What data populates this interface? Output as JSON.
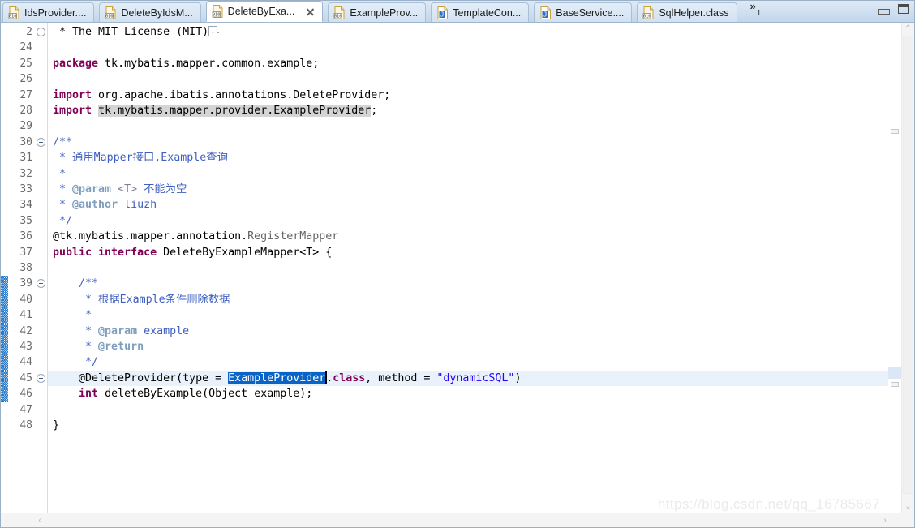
{
  "window": {
    "minimize_label": "Minimize",
    "maximize_label": "Maximize"
  },
  "tabs": {
    "overflow_chevron": "»",
    "overflow_count": "1",
    "items": [
      {
        "label": "IdsProvider....",
        "icon": "class-file-icon",
        "active": false,
        "closable": false
      },
      {
        "label": "DeleteByIdsM...",
        "icon": "class-file-icon",
        "active": false,
        "closable": false
      },
      {
        "label": "DeleteByExa...",
        "icon": "class-file-icon",
        "active": true,
        "closable": true
      },
      {
        "label": "ExampleProv...",
        "icon": "class-file-icon",
        "active": false,
        "closable": false
      },
      {
        "label": "TemplateCon...",
        "icon": "java-file-icon",
        "active": false,
        "closable": false
      },
      {
        "label": "BaseService....",
        "icon": "java-file-icon",
        "active": false,
        "closable": false
      },
      {
        "label": "SqlHelper.class",
        "icon": "class-file-icon",
        "active": false,
        "closable": false
      }
    ]
  },
  "editor": {
    "first_visible_line": 2,
    "current_line": 45,
    "selection_text": "ExampleProvider",
    "colors": {
      "keyword": "#7f0055",
      "javadoc": "#3f5fbf",
      "javadoc_tag": "#7f9fbf",
      "comment": "#3f7f5f",
      "string": "#2a00ff",
      "annotation": "#646464",
      "selection_bg": "#0a64c8",
      "current_line_bg": "#e9f1fb",
      "occurrence_bg": "#d4d4d4",
      "change_bar": "#1b73c8"
    },
    "lines": [
      {
        "num": "2",
        "fold": "plus",
        "change": false,
        "current": false,
        "tokens": [
          {
            "t": "comment",
            "v": " * The MIT License (MIT)"
          },
          {
            "t": "foldbox",
            "v": ""
          }
        ]
      },
      {
        "num": "24",
        "fold": null,
        "change": false,
        "current": false,
        "tokens": []
      },
      {
        "num": "25",
        "fold": null,
        "change": false,
        "current": false,
        "tokens": [
          {
            "t": "kw",
            "v": "package"
          },
          {
            "t": "plain",
            "v": " tk.mybatis.mapper.common.example;"
          }
        ]
      },
      {
        "num": "26",
        "fold": null,
        "change": false,
        "current": false,
        "tokens": []
      },
      {
        "num": "27",
        "fold": null,
        "change": false,
        "current": false,
        "tokens": [
          {
            "t": "kw",
            "v": "import"
          },
          {
            "t": "plain",
            "v": " org.apache.ibatis.annotations.DeleteProvider;"
          }
        ]
      },
      {
        "num": "28",
        "fold": null,
        "change": false,
        "current": false,
        "tokens": [
          {
            "t": "kw",
            "v": "import"
          },
          {
            "t": "plain",
            "v": " "
          },
          {
            "t": "occ",
            "v": "tk.mybatis.mapper.provider.ExampleProvider"
          },
          {
            "t": "plain",
            "v": ";"
          }
        ]
      },
      {
        "num": "29",
        "fold": null,
        "change": false,
        "current": false,
        "tokens": []
      },
      {
        "num": "30",
        "fold": "minus",
        "change": false,
        "current": false,
        "tokens": [
          {
            "t": "jdoc",
            "v": "/**"
          }
        ]
      },
      {
        "num": "31",
        "fold": null,
        "change": false,
        "current": false,
        "tokens": [
          {
            "t": "jdoc",
            "v": " * 通用Mapper接口,Example查询"
          }
        ]
      },
      {
        "num": "32",
        "fold": null,
        "change": false,
        "current": false,
        "tokens": [
          {
            "t": "jdoc",
            "v": " *"
          }
        ]
      },
      {
        "num": "33",
        "fold": null,
        "change": false,
        "current": false,
        "tokens": [
          {
            "t": "jdoc",
            "v": " * "
          },
          {
            "t": "jtag",
            "v": "@param"
          },
          {
            "t": "jhtml",
            "v": " <T> "
          },
          {
            "t": "jdoc",
            "v": "不能为空"
          }
        ]
      },
      {
        "num": "34",
        "fold": null,
        "change": false,
        "current": false,
        "tokens": [
          {
            "t": "jdoc",
            "v": " * "
          },
          {
            "t": "jtag",
            "v": "@author"
          },
          {
            "t": "jdoc",
            "v": " liuzh"
          }
        ]
      },
      {
        "num": "35",
        "fold": null,
        "change": false,
        "current": false,
        "tokens": [
          {
            "t": "jdoc",
            "v": " */"
          }
        ]
      },
      {
        "num": "36",
        "fold": null,
        "change": false,
        "current": false,
        "tokens": [
          {
            "t": "plain",
            "v": "@tk.mybatis.mapper.annotation."
          },
          {
            "t": "ann",
            "v": "RegisterMapper"
          }
        ]
      },
      {
        "num": "37",
        "fold": null,
        "change": false,
        "current": false,
        "tokens": [
          {
            "t": "kw",
            "v": "public interface"
          },
          {
            "t": "plain",
            "v": " DeleteByExampleMapper<T> {"
          }
        ]
      },
      {
        "num": "38",
        "fold": null,
        "change": false,
        "current": false,
        "tokens": []
      },
      {
        "num": "39",
        "fold": "minus",
        "change": true,
        "current": false,
        "tokens": [
          {
            "t": "jdoc",
            "v": "    /**"
          }
        ]
      },
      {
        "num": "40",
        "fold": null,
        "change": true,
        "current": false,
        "tokens": [
          {
            "t": "jdoc",
            "v": "     * 根据Example条件删除数据"
          }
        ]
      },
      {
        "num": "41",
        "fold": null,
        "change": true,
        "current": false,
        "tokens": [
          {
            "t": "jdoc",
            "v": "     *"
          }
        ]
      },
      {
        "num": "42",
        "fold": null,
        "change": true,
        "current": false,
        "tokens": [
          {
            "t": "jdoc",
            "v": "     * "
          },
          {
            "t": "jtag",
            "v": "@param"
          },
          {
            "t": "jdoc",
            "v": " example"
          }
        ]
      },
      {
        "num": "43",
        "fold": null,
        "change": true,
        "current": false,
        "tokens": [
          {
            "t": "jdoc",
            "v": "     * "
          },
          {
            "t": "jtag",
            "v": "@return"
          }
        ]
      },
      {
        "num": "44",
        "fold": null,
        "change": true,
        "current": false,
        "tokens": [
          {
            "t": "jdoc",
            "v": "     */"
          }
        ]
      },
      {
        "num": "45",
        "fold": "minus",
        "change": true,
        "current": true,
        "tokens": [
          {
            "t": "plain",
            "v": "    @DeleteProvider(type = "
          },
          {
            "t": "sel",
            "v": "ExampleProvider"
          },
          {
            "t": "caret",
            "v": ""
          },
          {
            "t": "plain",
            "v": "."
          },
          {
            "t": "kw",
            "v": "class"
          },
          {
            "t": "plain",
            "v": ", method = "
          },
          {
            "t": "str",
            "v": "\"dynamicSQL\""
          },
          {
            "t": "plain",
            "v": ")"
          }
        ]
      },
      {
        "num": "46",
        "fold": null,
        "change": true,
        "current": false,
        "tokens": [
          {
            "t": "plain",
            "v": "    "
          },
          {
            "t": "kw",
            "v": "int"
          },
          {
            "t": "plain",
            "v": " deleteByExample(Object example);"
          }
        ]
      },
      {
        "num": "47",
        "fold": null,
        "change": false,
        "current": false,
        "tokens": []
      },
      {
        "num": "48",
        "fold": null,
        "change": false,
        "current": false,
        "tokens": [
          {
            "t": "plain",
            "v": "}"
          }
        ]
      }
    ]
  },
  "scrollbars": {
    "vertical": {
      "up_arrow": "⌃",
      "down_arrow": "⌄"
    },
    "horizontal": {
      "left_arrow": "‹",
      "right_arrow": "›"
    }
  },
  "watermark": "https://blog.csdn.net/qq_16785667"
}
